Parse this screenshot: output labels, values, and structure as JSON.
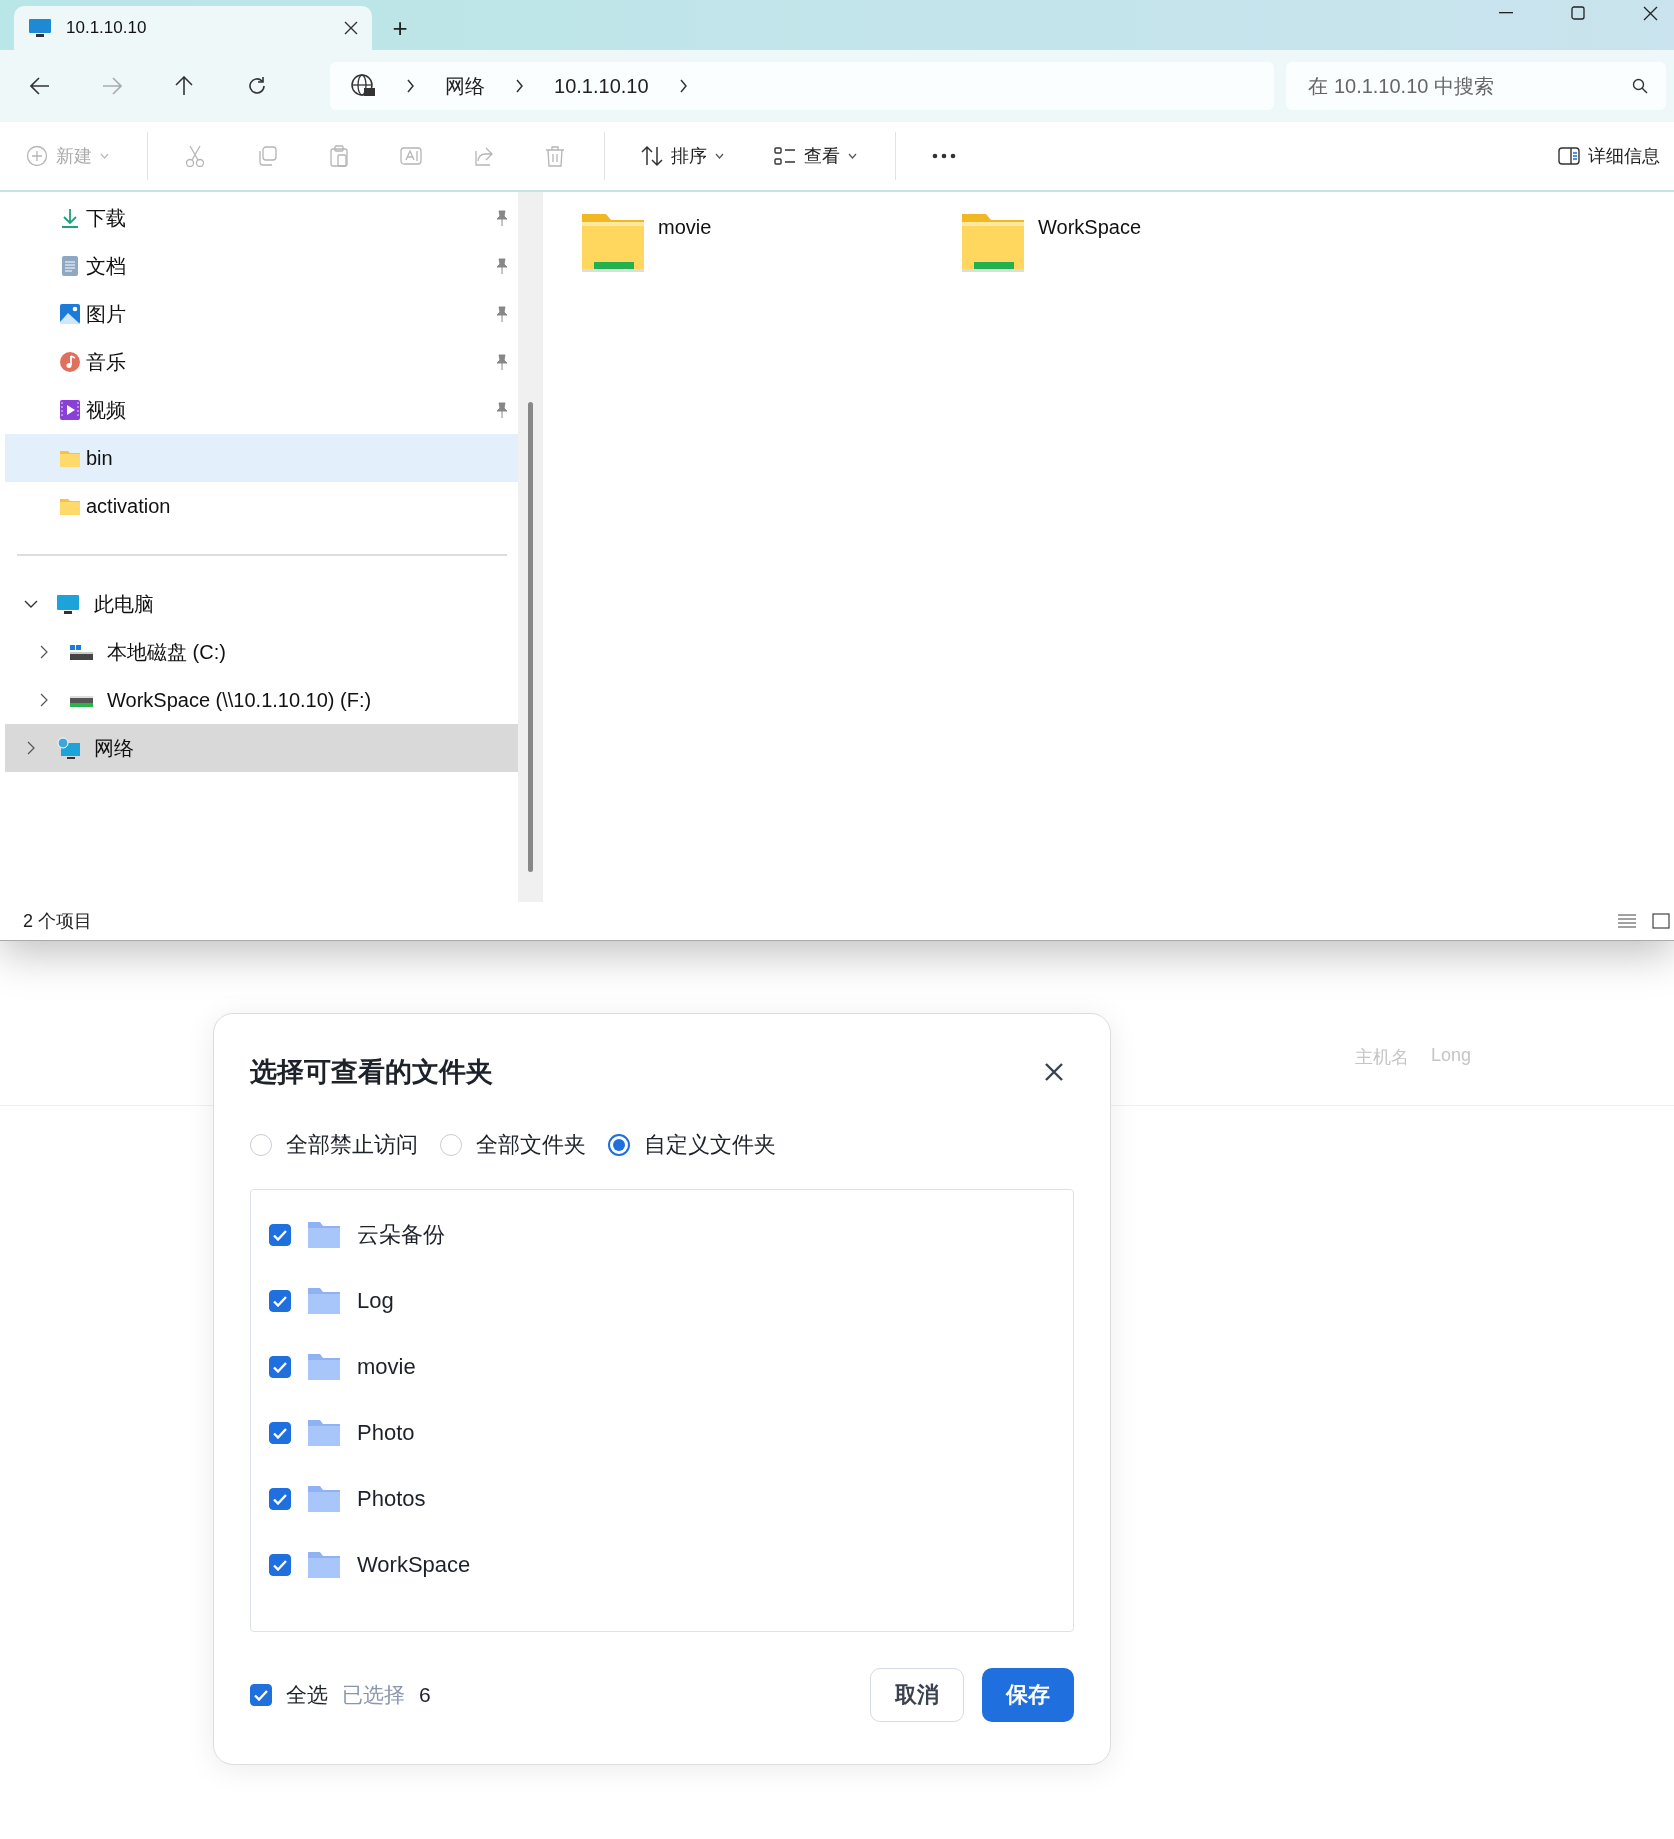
{
  "window": {
    "tab_title": "10.1.10.10",
    "new_tab": "+"
  },
  "address": {
    "breadcrumbs": [
      "网络",
      "10.1.10.10"
    ],
    "search_placeholder": "在 10.1.10.10 中搜索"
  },
  "toolbar": [
    {
      "kind": "new",
      "label": "新建",
      "disabled": true,
      "dropdown": true
    },
    {
      "kind": "cut",
      "disabled": true
    },
    {
      "kind": "copy",
      "disabled": true
    },
    {
      "kind": "paste",
      "disabled": true
    },
    {
      "kind": "rename",
      "disabled": true
    },
    {
      "kind": "share",
      "disabled": true
    },
    {
      "kind": "delete",
      "disabled": true
    },
    {
      "kind": "sort",
      "label": "排序",
      "disabled": false,
      "dropdown": true
    },
    {
      "kind": "view",
      "label": "查看",
      "disabled": false,
      "dropdown": true
    },
    {
      "kind": "more",
      "disabled": false
    },
    {
      "kind": "details",
      "label": "详细信息",
      "disabled": false
    }
  ],
  "quick_access": [
    {
      "kind": "download",
      "label": "下载",
      "pinned": true,
      "highlighted": false
    },
    {
      "kind": "documents",
      "label": "文档",
      "pinned": true,
      "highlighted": false
    },
    {
      "kind": "pictures",
      "label": "图片",
      "pinned": true,
      "highlighted": false
    },
    {
      "kind": "music",
      "label": "音乐",
      "pinned": true,
      "highlighted": false
    },
    {
      "kind": "videos",
      "label": "视频",
      "pinned": true,
      "highlighted": false
    },
    {
      "kind": "folder",
      "label": "bin",
      "pinned": false,
      "highlighted": true
    },
    {
      "kind": "folder",
      "label": "activation",
      "pinned": false,
      "highlighted": false
    }
  ],
  "tree": [
    {
      "kind": "pc",
      "label": "此电脑",
      "expanded": true,
      "selected": false,
      "children": [
        {
          "kind": "disk",
          "label": "本地磁盘 (C:)",
          "expanded": false,
          "selected": false
        },
        {
          "kind": "netdrive",
          "label": "WorkSpace (\\\\10.1.10.10) (F:)",
          "expanded": false,
          "selected": false
        }
      ]
    },
    {
      "kind": "network",
      "label": "网络",
      "expanded": false,
      "selected": true
    }
  ],
  "files": [
    {
      "name": "movie"
    },
    {
      "name": "WorkSpace"
    }
  ],
  "status_bar": {
    "count": "2 个项目"
  },
  "background_page": {
    "host_label": "主机名",
    "host_value": "Long"
  },
  "dialog": {
    "title": "选择可查看的文件夹",
    "options": [
      {
        "label": "全部禁止访问",
        "selected": false
      },
      {
        "label": "全部文件夹",
        "selected": false
      },
      {
        "label": "自定义文件夹",
        "selected": true
      }
    ],
    "folders": [
      {
        "name": "云朵备份",
        "checked": true
      },
      {
        "name": "Log",
        "checked": true
      },
      {
        "name": "movie",
        "checked": true
      },
      {
        "name": "Photo",
        "checked": true
      },
      {
        "name": "Photos",
        "checked": true
      },
      {
        "name": "WorkSpace",
        "checked": true
      }
    ],
    "select_all": {
      "label": "全选",
      "checked": true
    },
    "selected_label": "已选择",
    "selected_count": "6",
    "buttons": [
      {
        "kind": "secondary",
        "label": "取消"
      },
      {
        "kind": "primary",
        "label": "保存"
      }
    ]
  }
}
